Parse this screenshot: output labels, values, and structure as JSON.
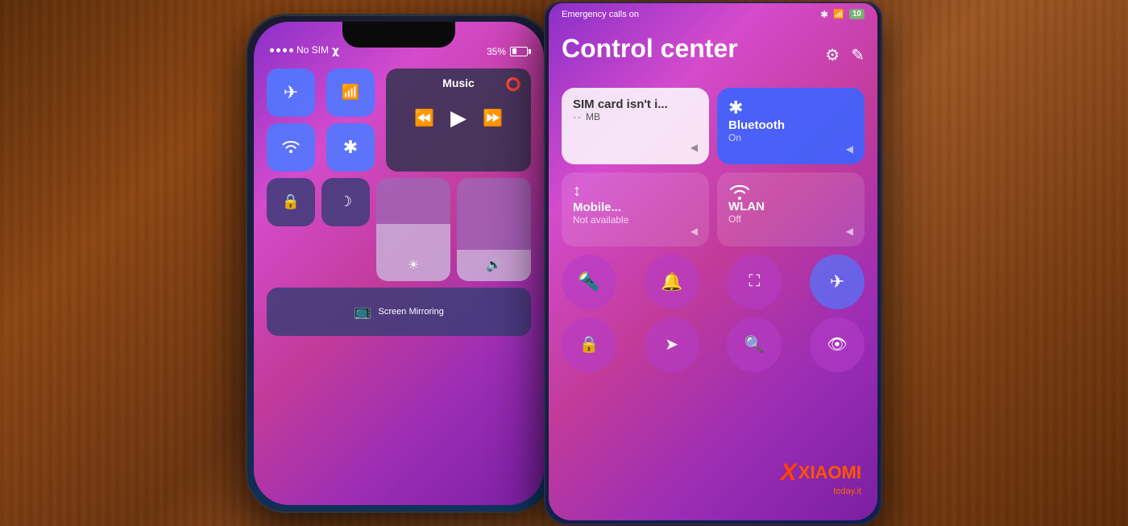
{
  "table": {
    "bg_description": "wooden table background"
  },
  "iphone": {
    "status": {
      "signal_label": "No SIM",
      "wifi": "wifi",
      "battery_percent": "35%"
    },
    "control_center": {
      "music_title": "Music",
      "screen_mirroring_label": "Screen\nMirroring",
      "tiles": [
        {
          "id": "airplane",
          "icon": "✈",
          "active": true
        },
        {
          "id": "cellular",
          "icon": "📶",
          "active": true
        },
        {
          "id": "wifi",
          "icon": "WiFi",
          "active": true
        },
        {
          "id": "bluetooth",
          "icon": "⚡",
          "active": true
        },
        {
          "id": "rotation",
          "icon": "🔒",
          "active": false
        },
        {
          "id": "donotdisturb",
          "icon": "☽",
          "active": false
        }
      ]
    }
  },
  "xiaomi": {
    "status": {
      "emergency_text": "Emergency calls on",
      "battery_label": "10"
    },
    "header": {
      "title": "Control center",
      "settings_icon": "⚙",
      "edit_icon": "✎"
    },
    "tiles": {
      "sim": {
        "title": "SIM card isn't i...",
        "sub": "-- MB",
        "active": false
      },
      "bluetooth": {
        "title": "Bluetooth",
        "sub": "On",
        "icon": "⚡",
        "active": true
      },
      "mobile": {
        "title": "Mobile...",
        "sub": "Not available",
        "icon": "↕",
        "active": false
      },
      "wlan": {
        "title": "WLAN",
        "sub": "Off",
        "icon": "WiFi",
        "active": false
      }
    },
    "round_buttons": [
      {
        "id": "flashlight",
        "icon": "🔦"
      },
      {
        "id": "alarm",
        "icon": "🔔"
      },
      {
        "id": "screenshot",
        "icon": "⊞"
      },
      {
        "id": "airplane",
        "icon": "✈"
      },
      {
        "id": "lock",
        "icon": "🔒"
      },
      {
        "id": "location",
        "icon": "➤"
      },
      {
        "id": "finddevice",
        "icon": "🔍"
      },
      {
        "id": "eye",
        "icon": "👁"
      }
    ],
    "logo": {
      "brand": "XIAOMI",
      "site": "today.it"
    }
  }
}
